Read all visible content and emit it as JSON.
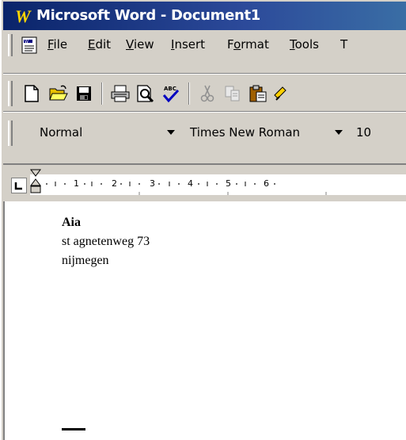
{
  "window": {
    "title": "Microsoft Word - Document1",
    "app_icon": "word-w-icon"
  },
  "menu": {
    "items": [
      {
        "label": "File",
        "underline": "F"
      },
      {
        "label": "Edit",
        "underline": "E"
      },
      {
        "label": "View",
        "underline": "V"
      },
      {
        "label": "Insert",
        "underline": "I"
      },
      {
        "label": "Format",
        "underline": "o"
      },
      {
        "label": "Tools",
        "underline": "T"
      },
      {
        "label": "T",
        "underline": ""
      }
    ]
  },
  "toolbar": {
    "buttons": [
      "new-document-icon",
      "open-folder-icon",
      "save-disk-icon",
      "print-icon",
      "print-preview-icon",
      "spelling-check-icon",
      "cut-scissors-icon",
      "copy-icon",
      "paste-icon",
      "format-painter-icon"
    ]
  },
  "formatting": {
    "style": "Normal",
    "font": "Times New Roman",
    "size": "10"
  },
  "ruler": {
    "numbers": [
      "1",
      "2",
      "3",
      "4",
      "5",
      "6"
    ]
  },
  "document": {
    "lines": [
      "Aia",
      "st agnetenweg 73",
      "nijmegen"
    ]
  },
  "colors": {
    "title_bar": "#0a246a",
    "chrome": "#d4d0c8",
    "page": "#ffffff"
  }
}
